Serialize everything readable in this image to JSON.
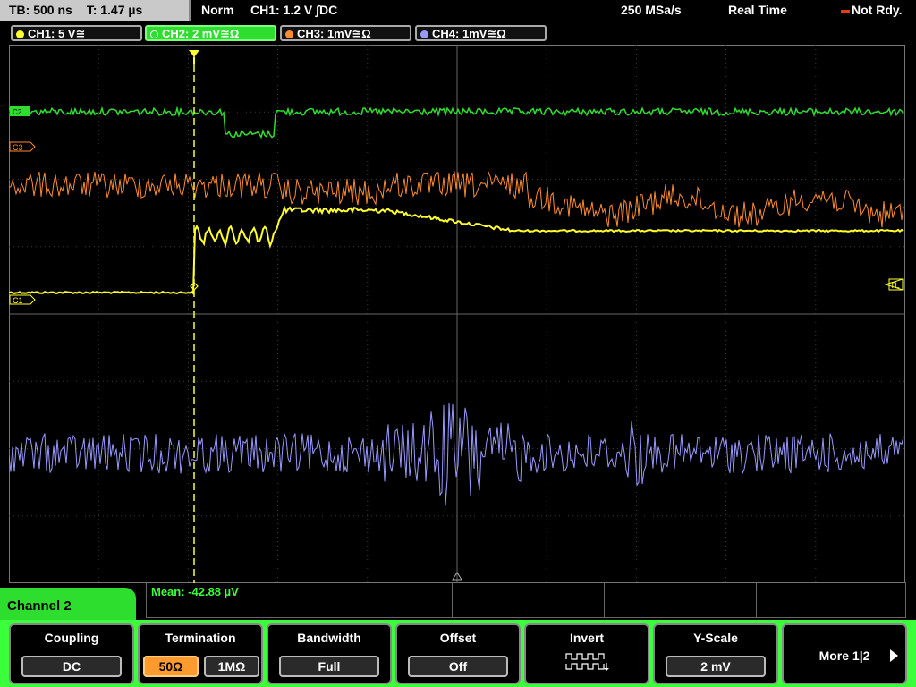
{
  "topbar": {
    "timebase": "TB: 500 ns",
    "trigger_time": "T: 1.47 µs",
    "mode": "Norm",
    "trigger_info": "CH1: 1.2 V ∫DC",
    "sample_rate": "250 MSa/s",
    "acq_mode": "Real Time",
    "status": "Not Rdy."
  },
  "channels": [
    {
      "label": "CH1: 5 V≅",
      "color": "#ffff2e"
    },
    {
      "label": "CH2: 2 mV≅Ω",
      "color": "#2ede2e"
    },
    {
      "label": "CH3: 1mV≅Ω",
      "color": "#ff8c2e"
    },
    {
      "label": "CH4: 1mV≅Ω",
      "color": "#9999ff"
    }
  ],
  "markers": {
    "c3": "C3",
    "c1": "C1",
    "tl": "TL",
    "c2": "C2"
  },
  "measurement": {
    "mean": "Mean: -42.88 µV"
  },
  "menu": {
    "title": "Channel 2",
    "coupling": {
      "title": "Coupling",
      "value": "DC"
    },
    "termination": {
      "title": "Termination",
      "opt1": "50Ω",
      "opt2": "1MΩ"
    },
    "bandwidth": {
      "title": "Bandwidth",
      "value": "Full"
    },
    "offset": {
      "title": "Offset",
      "value": "Off"
    },
    "invert": {
      "title": "Invert"
    },
    "yscale": {
      "title": "Y-Scale",
      "value": "2 mV"
    },
    "more": {
      "title": "More 1|2"
    }
  },
  "colors": {
    "ch1": "#ffff2e",
    "ch2": "#2ede2e",
    "ch3": "#ff8c2e",
    "ch4": "#9999ff",
    "accent": "#3aff3a"
  }
}
